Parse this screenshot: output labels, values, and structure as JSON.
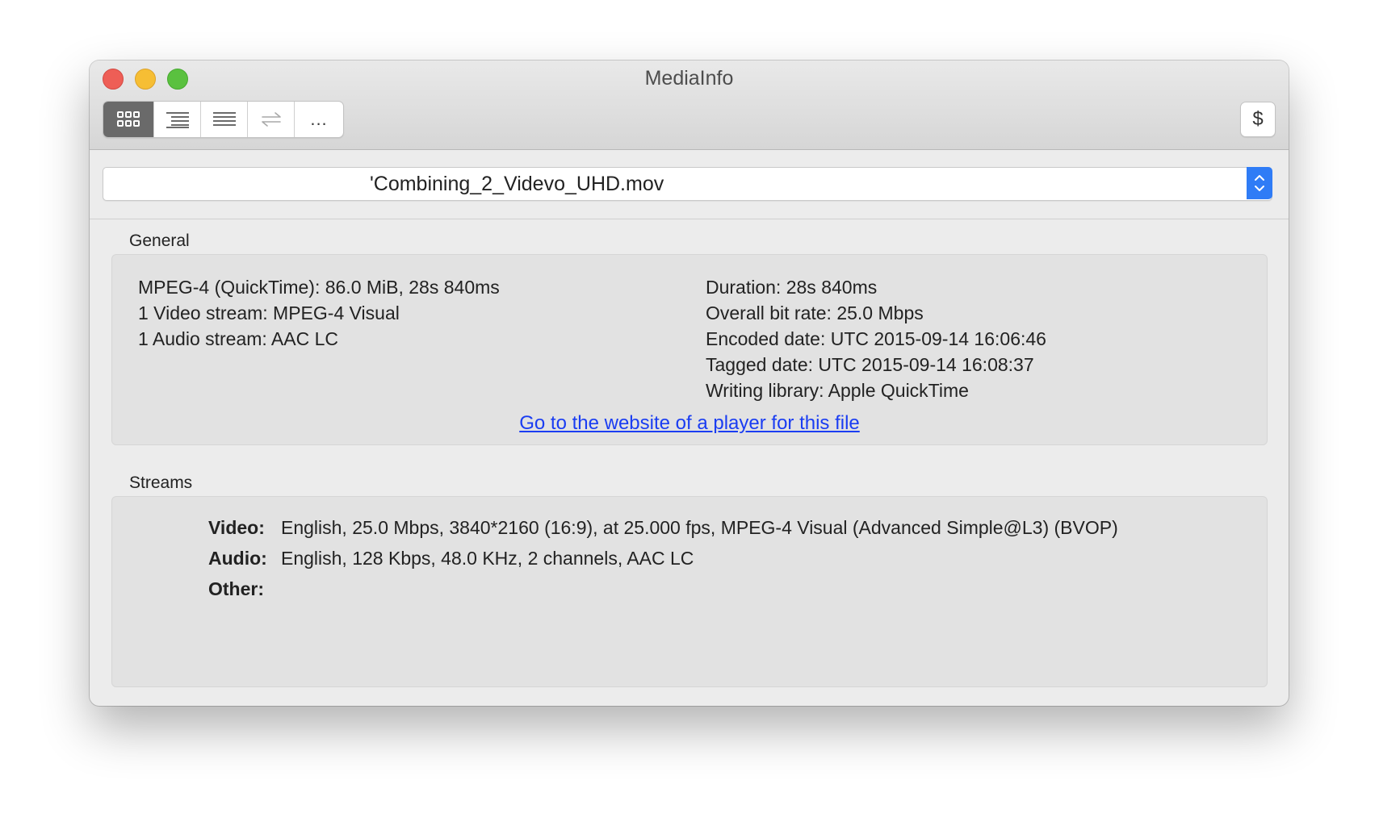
{
  "window": {
    "title": "MediaInfo"
  },
  "toolbar": {
    "views": [
      {
        "icon": "basic-view-icon",
        "active": true
      },
      {
        "icon": "tree-view-icon",
        "active": false
      },
      {
        "icon": "text-view-icon",
        "active": false
      },
      {
        "icon": "compare-icon",
        "active": false
      },
      {
        "label": "...",
        "active": false
      }
    ],
    "donate_label": "$"
  },
  "file": {
    "selected": "'Combining_2_Videvo_UHD.mov"
  },
  "general": {
    "heading": "General",
    "left": [
      "MPEG-4 (QuickTime): 86.0 MiB, 28s 840ms",
      "1 Video stream: MPEG-4 Visual",
      "1 Audio stream: AAC LC"
    ],
    "right": [
      "Duration: 28s 840ms",
      "Overall bit rate: 25.0 Mbps",
      "Encoded date: UTC 2015-09-14 16:06:46",
      "Tagged date: UTC 2015-09-14 16:08:37",
      "Writing library: Apple QuickTime"
    ],
    "player_link": "Go to the website of a player for this file"
  },
  "streams": {
    "heading": "Streams",
    "rows": [
      {
        "label": "Video:",
        "value": "English, 25.0 Mbps, 3840*2160 (16:9), at 25.000 fps, MPEG-4 Visual (Advanced Simple@L3) (BVOP)"
      },
      {
        "label": "Audio:",
        "value": "English, 128 Kbps, 48.0 KHz, 2 channels, AAC LC"
      },
      {
        "label": "Other:",
        "value": ""
      }
    ]
  }
}
